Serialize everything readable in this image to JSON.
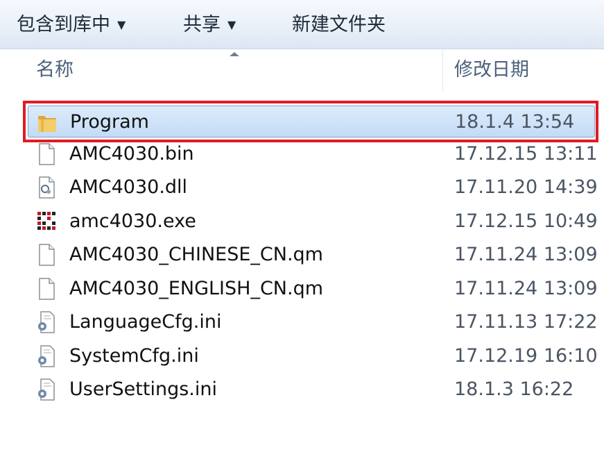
{
  "toolbar": {
    "include_library": "包含到库中",
    "share": "共享",
    "new_folder": "新建文件夹"
  },
  "columns": {
    "name": "名称",
    "date_modified": "修改日期"
  },
  "files": [
    {
      "name": "Program",
      "date": "18.1.4 13:54",
      "icon": "folder-icon",
      "selected": true
    },
    {
      "name": "AMC4030.bin",
      "date": "17.12.15 13:11",
      "icon": "blank-file-icon"
    },
    {
      "name": "AMC4030.dll",
      "date": "17.11.20 14:39",
      "icon": "dll-file-icon"
    },
    {
      "name": "amc4030.exe",
      "date": "17.12.15 10:49",
      "icon": "exe-app-icon"
    },
    {
      "name": "AMC4030_CHINESE_CN.qm",
      "date": "17.11.24 13:09",
      "icon": "blank-file-icon"
    },
    {
      "name": "AMC4030_ENGLISH_CN.qm",
      "date": "17.11.24 13:09",
      "icon": "blank-file-icon"
    },
    {
      "name": "LanguageCfg.ini",
      "date": "17.11.13 17:22",
      "icon": "ini-settings-icon"
    },
    {
      "name": "SystemCfg.ini",
      "date": "17.12.19 16:10",
      "icon": "ini-settings-icon"
    },
    {
      "name": "UserSettings.ini",
      "date": "18.1.3 16:22",
      "icon": "ini-settings-icon"
    }
  ],
  "colors": {
    "highlight_outline": "#e01b24",
    "selection_fill": "#cfe2f8"
  }
}
